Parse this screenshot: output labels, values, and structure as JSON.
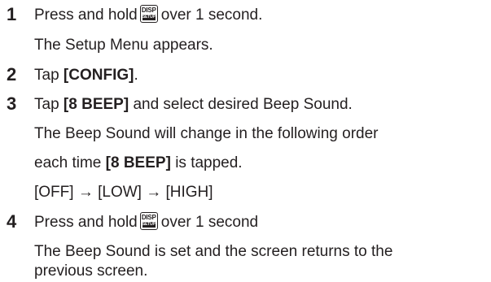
{
  "key_icon": {
    "top_label": "DISP",
    "bottom_label": "SETUP"
  },
  "steps": [
    {
      "number": "1",
      "action_before": "Press and hold",
      "action_after": "over 1 second.",
      "result": "The Setup Menu appears."
    },
    {
      "number": "2",
      "action_before": "Tap",
      "action_bold": "[CONFIG]",
      "action_after": "."
    },
    {
      "number": "3",
      "action_before": "Tap",
      "action_bold": "[8 BEEP]",
      "action_after": "and select desired Beep Sound.",
      "result_line1": "The Beep Sound will change in the following order",
      "result_line2_before": "each time",
      "result_line2_bold": "[8 BEEP]",
      "result_line2_after": "is tapped.",
      "sequence": "[OFF] → [LOW] → [HIGH]"
    },
    {
      "number": "4",
      "action_before": "Press and hold",
      "action_after": "over 1 second",
      "result_line1": "The Beep Sound is set and the screen returns to the",
      "result_line2": "previous screen."
    }
  ]
}
